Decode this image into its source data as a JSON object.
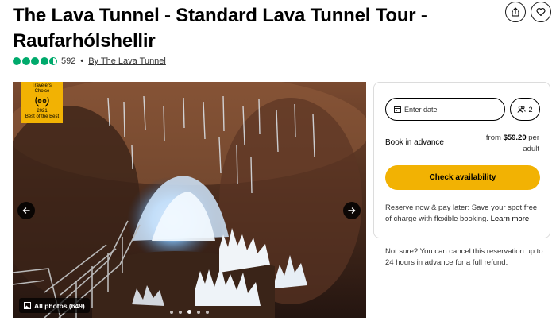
{
  "page": {
    "title": "The Lava Tunnel - Standard Lava Tunnel Tour - Raufarhólshellir"
  },
  "header_actions": {
    "share_icon": "share-icon",
    "save_icon": "heart-icon"
  },
  "rating": {
    "bubbles": 4.5,
    "review_count": "592",
    "separator": "•",
    "by_label": "By The Lava Tunnel"
  },
  "hero": {
    "badge": {
      "line1": "Travelers'",
      "line2": "Choice",
      "year": "2021",
      "line3": "Best of the Best"
    },
    "all_photos_label": "All photos (649)",
    "carousel_dots": 5,
    "active_dot": 2
  },
  "booking": {
    "date_placeholder": "Enter date",
    "guests": "2",
    "book_label": "Book in advance",
    "price_prefix": "from ",
    "price": "$59.20",
    "price_suffix": " per adult",
    "cta": "Check availability",
    "reserve_text": "Reserve now & pay later: Save your spot free of charge with flexible booking.",
    "learn_more": "Learn more"
  },
  "cancellation_note": "Not sure? You can cancel this reservation up to 24 hours in advance for a full refund.",
  "colors": {
    "rating_green": "#00aa6c",
    "accent_yellow": "#f2b203"
  }
}
